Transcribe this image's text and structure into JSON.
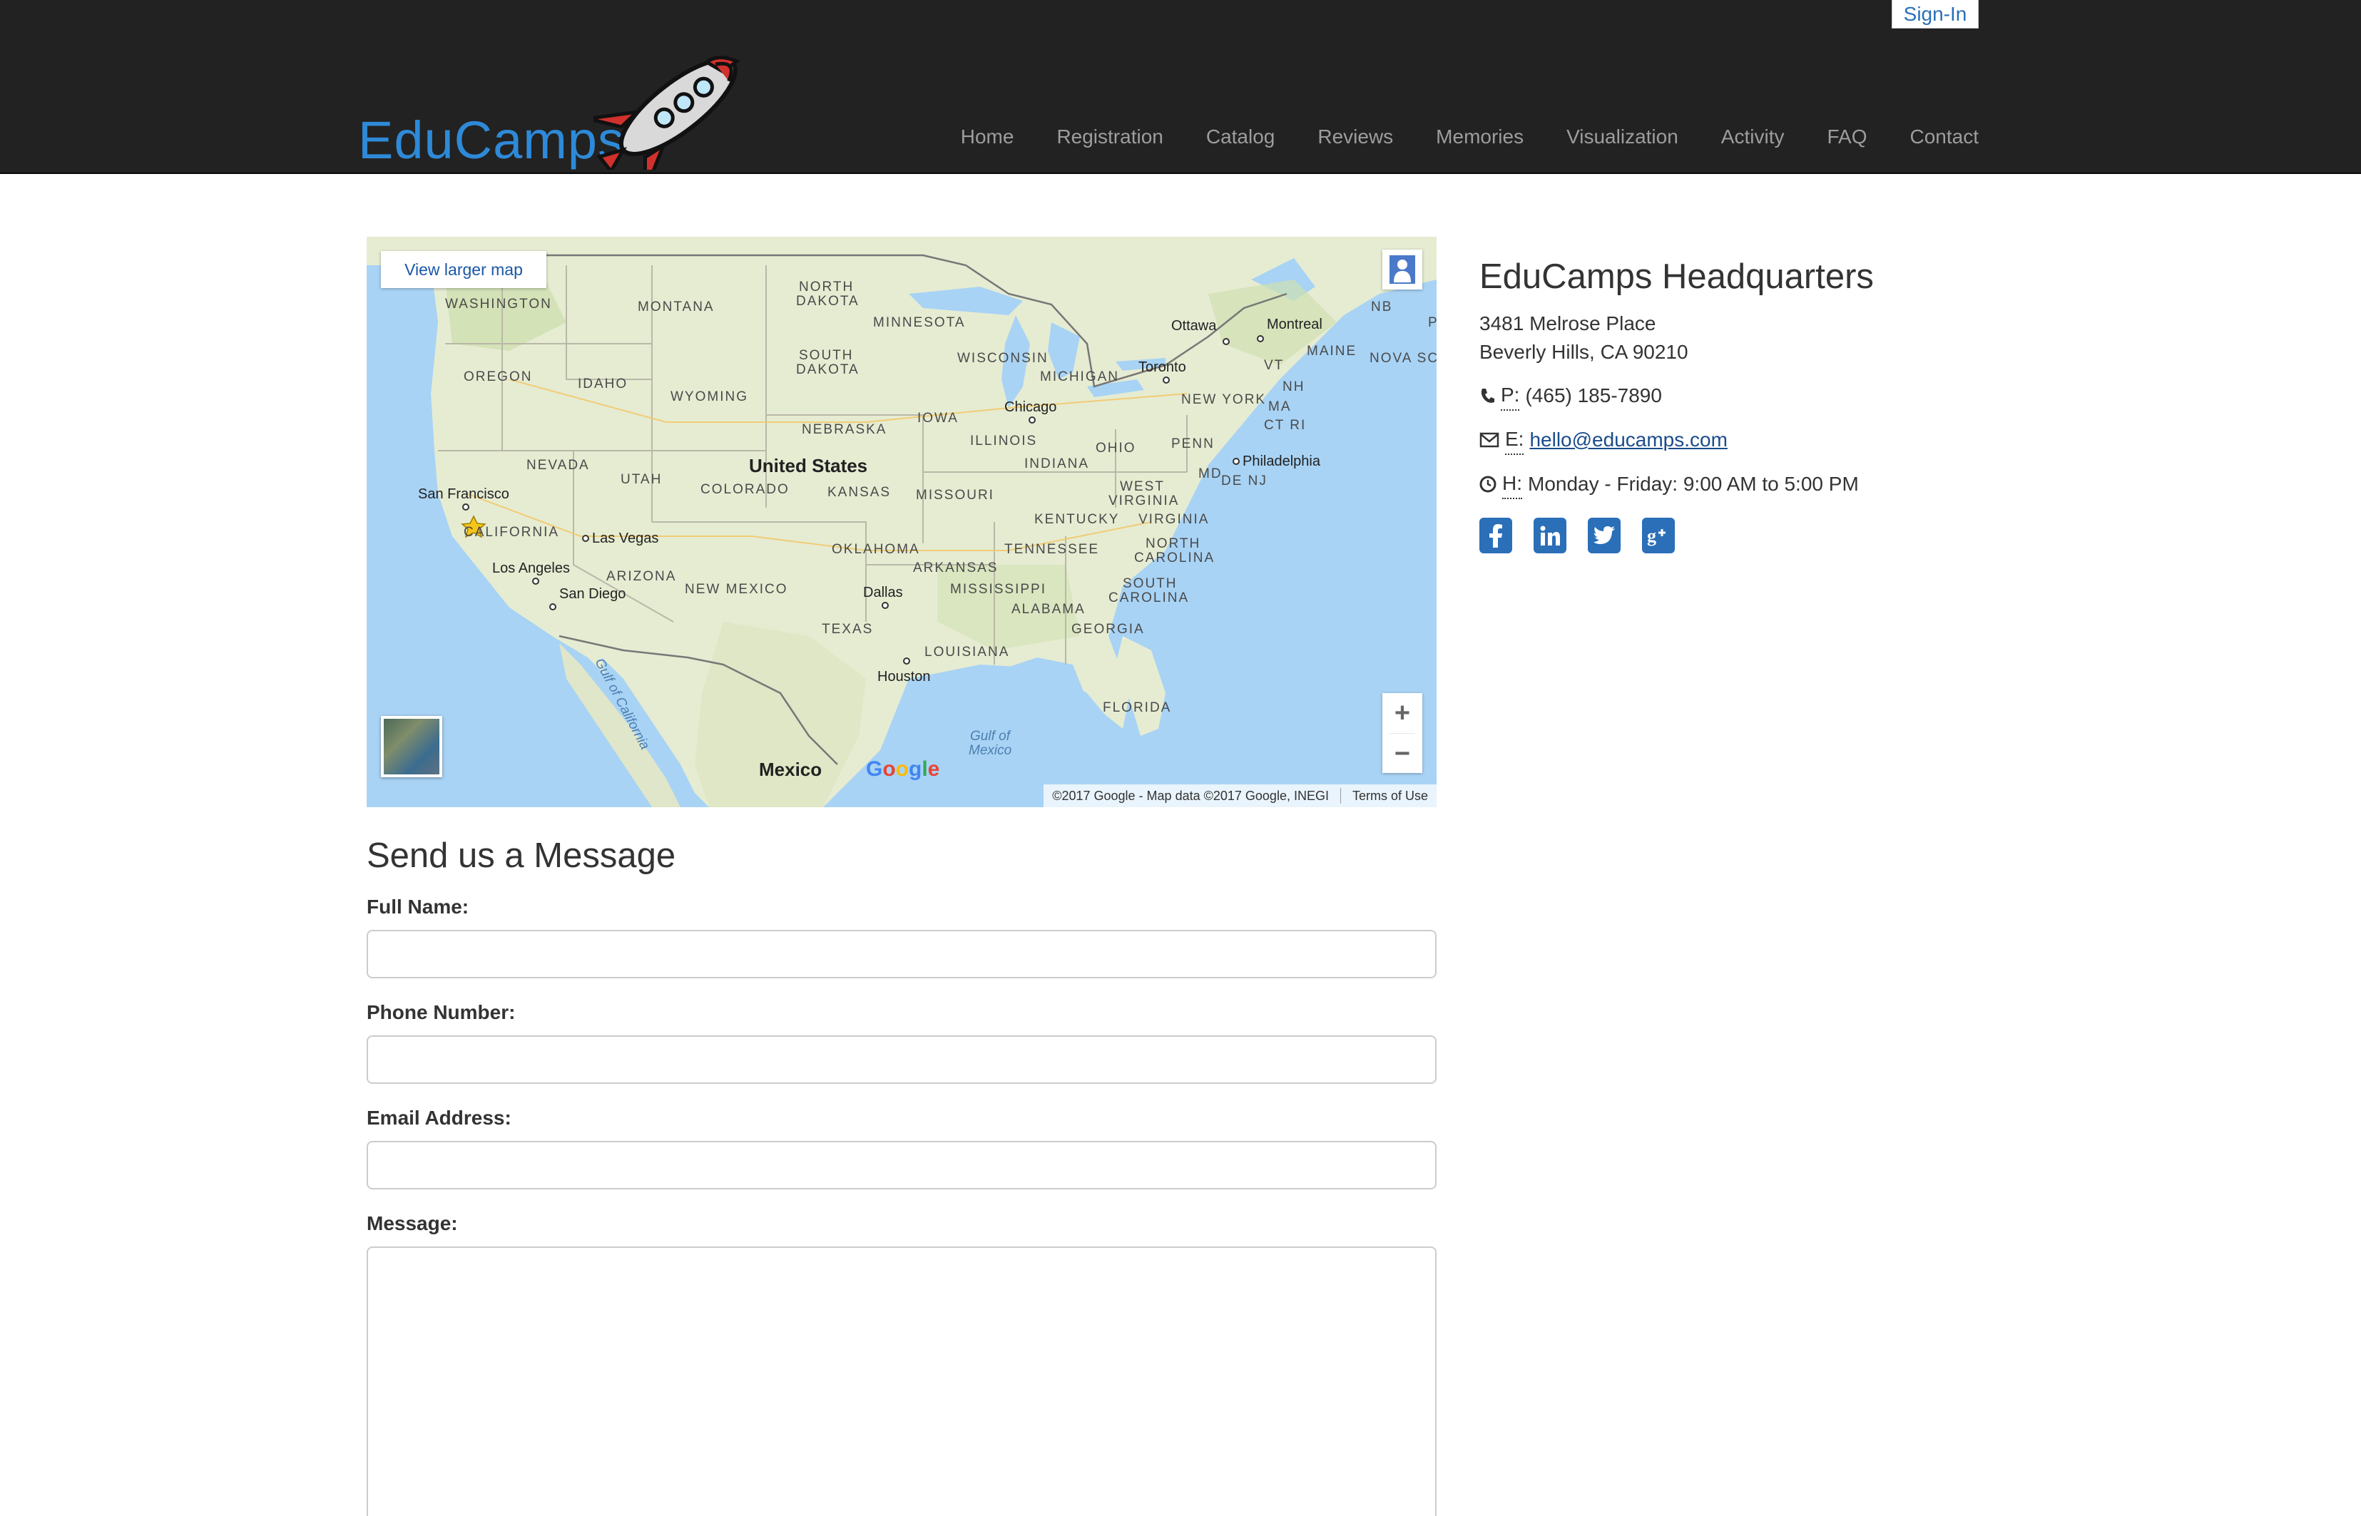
{
  "header": {
    "signin_label": "Sign-In",
    "brand_name": "EduCamps",
    "nav": [
      {
        "label": "Home"
      },
      {
        "label": "Registration"
      },
      {
        "label": "Catalog"
      },
      {
        "label": "Reviews"
      },
      {
        "label": "Memories"
      },
      {
        "label": "Visualization"
      },
      {
        "label": "Activity"
      },
      {
        "label": "FAQ"
      },
      {
        "label": "Contact"
      }
    ]
  },
  "map": {
    "view_larger_label": "View larger map",
    "zoom_in": "+",
    "zoom_out": "−",
    "google_logo": "Google",
    "attribution": "©2017 Google - Map data ©2017 Google, INEGI",
    "terms": "Terms of Use",
    "labels": {
      "washington": "WASHINGTON",
      "montana": "MONTANA",
      "north_dakota_1": "NORTH",
      "north_dakota_2": "DAKOTA",
      "minnesota": "MINNESOTA",
      "south_dakota_1": "SOUTH",
      "south_dakota_2": "DAKOTA",
      "wisconsin": "WISCONSIN",
      "michigan": "MICHIGAN",
      "oregon": "OREGON",
      "idaho": "IDAHO",
      "wyoming": "WYOMING",
      "nebraska": "NEBRASKA",
      "iowa": "IOWA",
      "illinois": "ILLINOIS",
      "indiana": "INDIANA",
      "ohio": "OHIO",
      "penn": "PENN",
      "nevada": "NEVADA",
      "utah": "UTAH",
      "colorado": "COLORADO",
      "kansas": "KANSAS",
      "missouri": "MISSOURI",
      "kentucky": "KENTUCKY",
      "west_virginia_1": "WEST",
      "west_virginia_2": "VIRGINIA",
      "virginia": "VIRGINIA",
      "california": "CALIFORNIA",
      "arizona": "ARIZONA",
      "new_mexico": "NEW MEXICO",
      "oklahoma": "OKLAHOMA",
      "arkansas": "ARKANSAS",
      "tennessee": "TENNESSEE",
      "north_carolina_1": "NORTH",
      "north_carolina_2": "CAROLINA",
      "mississippi": "MISSISSIPPI",
      "alabama": "ALABAMA",
      "south_carolina_1": "SOUTH",
      "south_carolina_2": "CAROLINA",
      "georgia": "GEORGIA",
      "texas": "TEXAS",
      "louisiana": "LOUISIANA",
      "florida": "FLORIDA",
      "new_york": "NEW YORK",
      "vt": "VT",
      "nh": "NH",
      "ma": "MA",
      "ct_ri": "CT RI",
      "md": "MD",
      "de_nj": "DE NJ",
      "maine": "MAINE",
      "nb": "NB",
      "nova_scotia": "NOVA SC",
      "p": "P",
      "united_states": "United States",
      "mexico": "Mexico",
      "gulf_california": "Gulf of California",
      "gulf_mexico_1": "Gulf of",
      "gulf_mexico_2": "Mexico"
    },
    "cities": {
      "ottawa": "Ottawa",
      "montreal": "Montreal",
      "toronto": "Toronto",
      "chicago": "Chicago",
      "philadelphia": "Philadelphia",
      "san_francisco": "San Francisco",
      "las_vegas": "Las Vegas",
      "los_angeles": "Los Angeles",
      "san_diego": "San Diego",
      "dallas": "Dallas",
      "houston": "Houston"
    }
  },
  "info": {
    "title": "EduCamps Headquarters",
    "address_line1": "3481 Melrose Place",
    "address_line2": "Beverly Hills, CA 90210",
    "phone_abbr": "P:",
    "phone": "(465) 185-7890",
    "email_abbr": "E:",
    "email": "hello@educamps.com",
    "hours_abbr": "H:",
    "hours": "Monday - Friday: 9:00 AM to 5:00 PM",
    "social_icons": [
      "facebook-icon",
      "linkedin-icon",
      "twitter-icon",
      "google-plus-icon"
    ]
  },
  "form": {
    "title": "Send us a Message",
    "full_name_label": "Full Name:",
    "full_name_value": "",
    "phone_label": "Phone Number:",
    "phone_value": "",
    "email_label": "Email Address:",
    "email_value": "",
    "message_label": "Message:",
    "message_value": ""
  },
  "colors": {
    "navbar": "#222222",
    "nav_text": "#9d9d9d",
    "brand_blue": "#2e8ad8",
    "link": "#1a4c8a",
    "social": "#2a6fb8",
    "water": "#a8d3f5",
    "land": "#e7ecd3"
  }
}
